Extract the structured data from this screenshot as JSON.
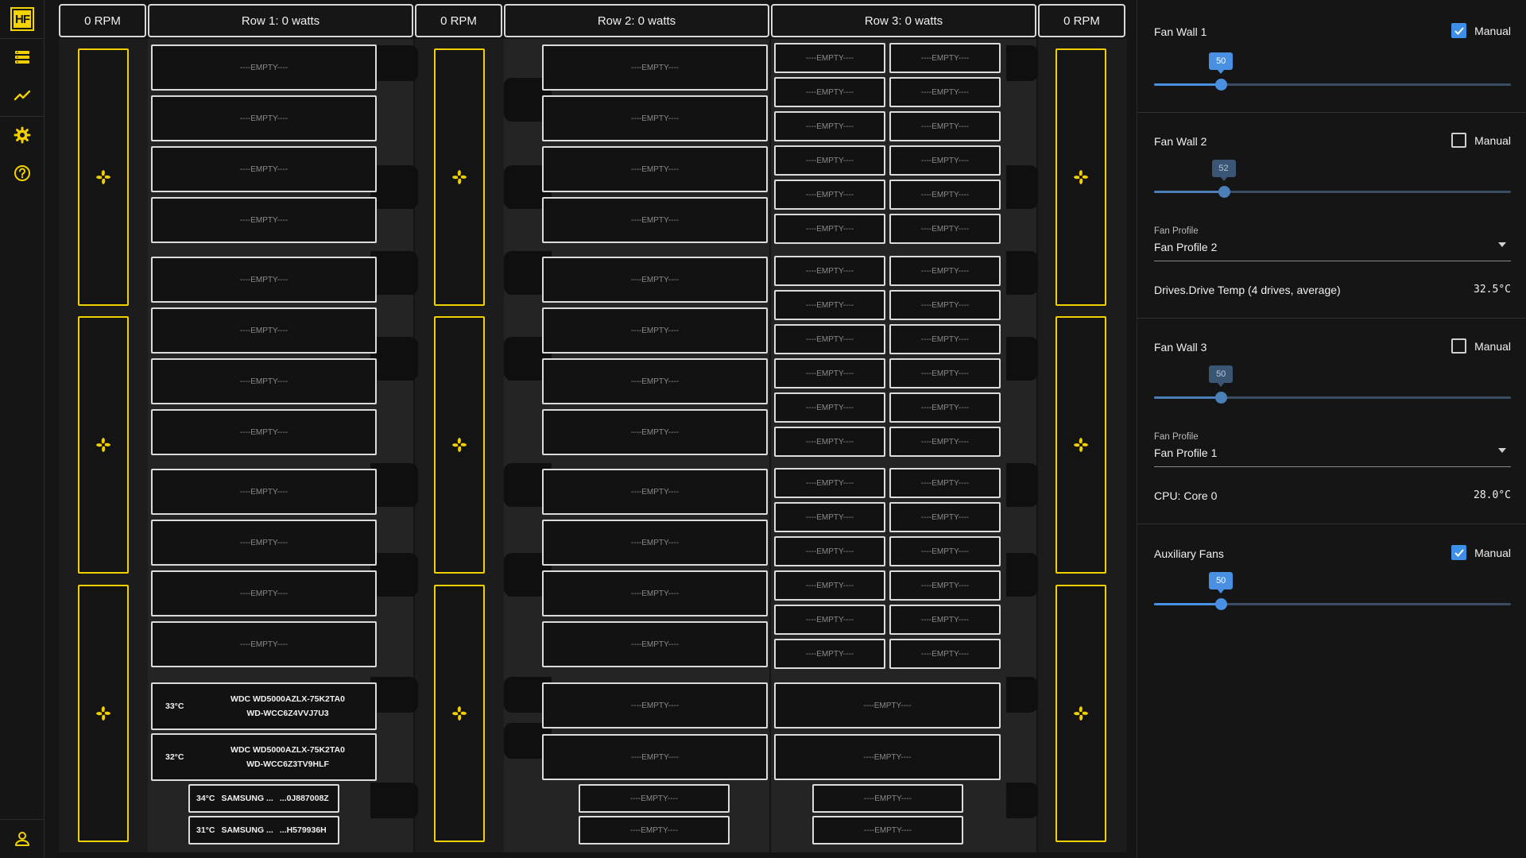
{
  "nav": {
    "logo": "HF",
    "items": [
      "storage-icon",
      "chart-icon",
      "gear-icon",
      "help-icon"
    ],
    "footer": "user-icon"
  },
  "headers": {
    "fan_col_1": "0 RPM",
    "row_1": "Row 1: 0 watts",
    "fan_col_2": "0 RPM",
    "row_2": "Row 2: 0 watts",
    "row_3": "Row 3: 0 watts",
    "fan_col_3": "0 RPM"
  },
  "empty_label": "----EMPTY----",
  "row1": {
    "drives": [
      {
        "temp": "33°C",
        "model": "WDC WD5000AZLX-75K2TA0",
        "serial": "WD-WCC6Z4VVJ7U3"
      },
      {
        "temp": "32°C",
        "model": "WDC WD5000AZLX-75K2TA0",
        "serial": "WD-WCC6Z3TV9HLF"
      }
    ],
    "ssds": [
      {
        "temp": "34°C",
        "model": "SAMSUNG ...",
        "serial": "...0J887008Z"
      },
      {
        "temp": "31°C",
        "model": "SAMSUNG ...",
        "serial": "...H579936H"
      }
    ]
  },
  "accent": "#f2d000",
  "slider_color": "#4a90e2",
  "settings": {
    "fan_wall_1": {
      "title": "Fan Wall 1",
      "manual_label": "Manual",
      "manual": true,
      "value": 50
    },
    "fan_wall_2": {
      "title": "Fan Wall 2",
      "manual_label": "Manual",
      "manual": false,
      "value": 52,
      "profile_label": "Fan Profile",
      "profile": "Fan Profile 2",
      "sensor": "Drives.Drive Temp (4 drives, average)",
      "sensor_value": "32.5°C"
    },
    "fan_wall_3": {
      "title": "Fan Wall 3",
      "manual_label": "Manual",
      "manual": false,
      "value": 50,
      "profile_label": "Fan Profile",
      "profile": "Fan Profile 1",
      "sensor": "CPU: Core 0",
      "sensor_value": "28.0°C"
    },
    "auxiliary": {
      "title": "Auxiliary Fans",
      "manual_label": "Manual",
      "manual": true,
      "value": 50
    }
  }
}
